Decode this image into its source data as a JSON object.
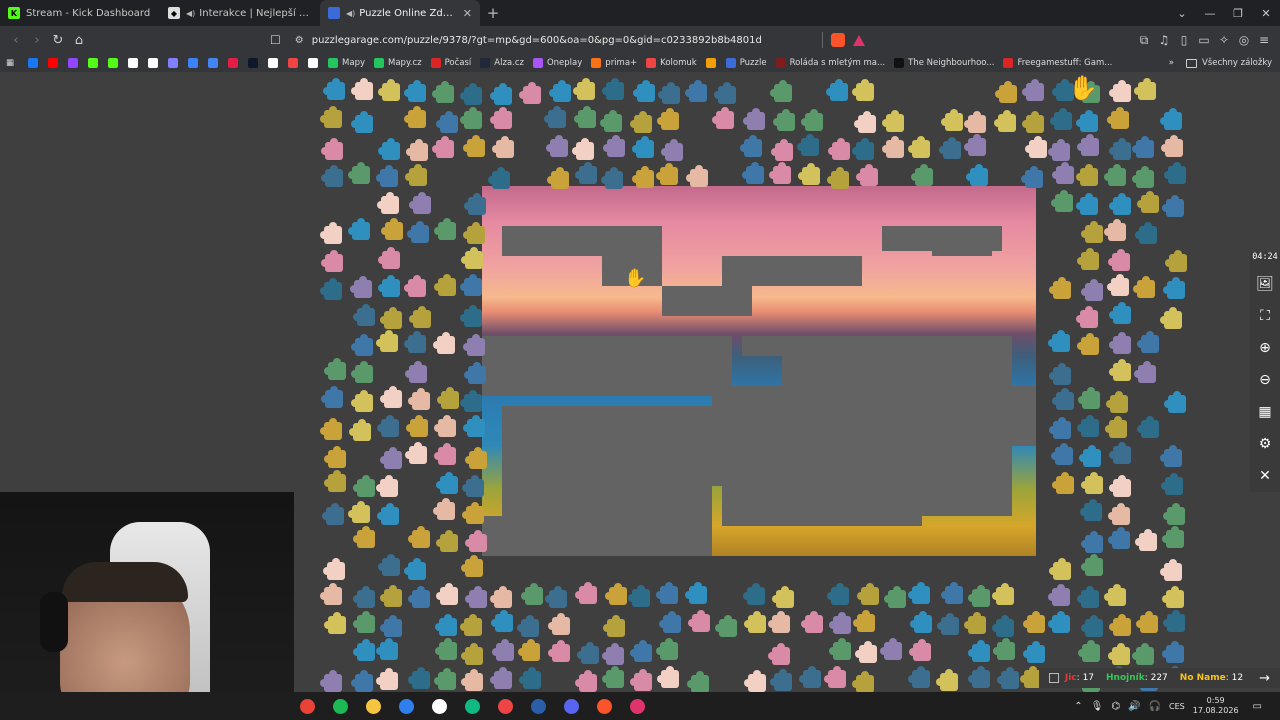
{
  "tabs": [
    {
      "title": "Stream - Kick Dashboard",
      "icon": "kick-icon",
      "color": "#53fc18",
      "active": false
    },
    {
      "title": "Interakce | Nejlepší software pro",
      "icon": "interakce-icon",
      "color": "#dddddd",
      "active": false
    },
    {
      "title": "Puzzle Online Zdarma | Puzzle",
      "icon": "puzzle-icon",
      "color": "#3b6bd8",
      "active": true
    }
  ],
  "url": "puzzlegarage.com/puzzle/9378/?gt=mp&gd=600&oa=0&pg=0&gid=c0233892b8b4801d",
  "bookmarks": [
    {
      "label": "",
      "color": "#1877f2"
    },
    {
      "label": "",
      "color": "#ff0000"
    },
    {
      "label": "",
      "color": "#9146ff"
    },
    {
      "label": "",
      "color": "#53fc18"
    },
    {
      "label": "",
      "color": "#53fc18"
    },
    {
      "label": "",
      "color": "#ffffff"
    },
    {
      "label": "",
      "color": "#ffffff"
    },
    {
      "label": "",
      "color": "#7f7fff"
    },
    {
      "label": "",
      "color": "#3b82f6"
    },
    {
      "label": "",
      "color": "#4285f4"
    },
    {
      "label": "",
      "color": "#e11d48"
    },
    {
      "label": "",
      "color": "#0f172a"
    },
    {
      "label": "",
      "color": "#ffffff"
    },
    {
      "label": "",
      "color": "#ef4444"
    },
    {
      "label": "",
      "color": "#ffffff"
    },
    {
      "label": "Mapy",
      "color": "#22c55e"
    },
    {
      "label": "Mapy.cz",
      "color": "#22c55e"
    },
    {
      "label": "Počasí",
      "color": "#dc2626"
    },
    {
      "label": "Alza.cz",
      "color": "#1f2937"
    },
    {
      "label": "Oneplay",
      "color": "#a855f7"
    },
    {
      "label": "prima+",
      "color": "#f97316"
    },
    {
      "label": "Kolomuk",
      "color": "#ef4444"
    },
    {
      "label": "",
      "color": "#f59e0b"
    },
    {
      "label": "Puzzle",
      "color": "#3b6bd8"
    },
    {
      "label": "Roláda s mletým ma...",
      "color": "#7f1d1d"
    },
    {
      "label": "The Neighbourhoo...",
      "color": "#111111"
    },
    {
      "label": "Freegamestuff: Gam...",
      "color": "#dc2626"
    }
  ],
  "bookmarks_more": "»",
  "bookmarks_all": "Všechny záložky",
  "timer": "04:24",
  "scores": [
    {
      "name": "Jic",
      "value": "17",
      "color": "#e03a3a"
    },
    {
      "name": "Hnojník",
      "value": "227",
      "color": "#34c759"
    },
    {
      "name": "No Name",
      "value": "12",
      "color": "#f5c518"
    }
  ],
  "tray": {
    "lang": "CES",
    "time": "0:59",
    "date": "17.08.2026"
  },
  "taskbar_apps": [
    {
      "name": "chrome-app",
      "color": "#ea4335"
    },
    {
      "name": "spotify-app",
      "color": "#1db954"
    },
    {
      "name": "explorer-app",
      "color": "#f5c542"
    },
    {
      "name": "vscode-app",
      "color": "#2f80ed"
    },
    {
      "name": "app-5",
      "color": "#ffffff"
    },
    {
      "name": "app-6",
      "color": "#10b981"
    },
    {
      "name": "app-7",
      "color": "#ef4444"
    },
    {
      "name": "steam-app",
      "color": "#2a5ea8"
    },
    {
      "name": "discord-app",
      "color": "#5865f2"
    },
    {
      "name": "brave-app",
      "color": "#fb542b"
    },
    {
      "name": "app-11",
      "color": "#e0336b"
    }
  ]
}
